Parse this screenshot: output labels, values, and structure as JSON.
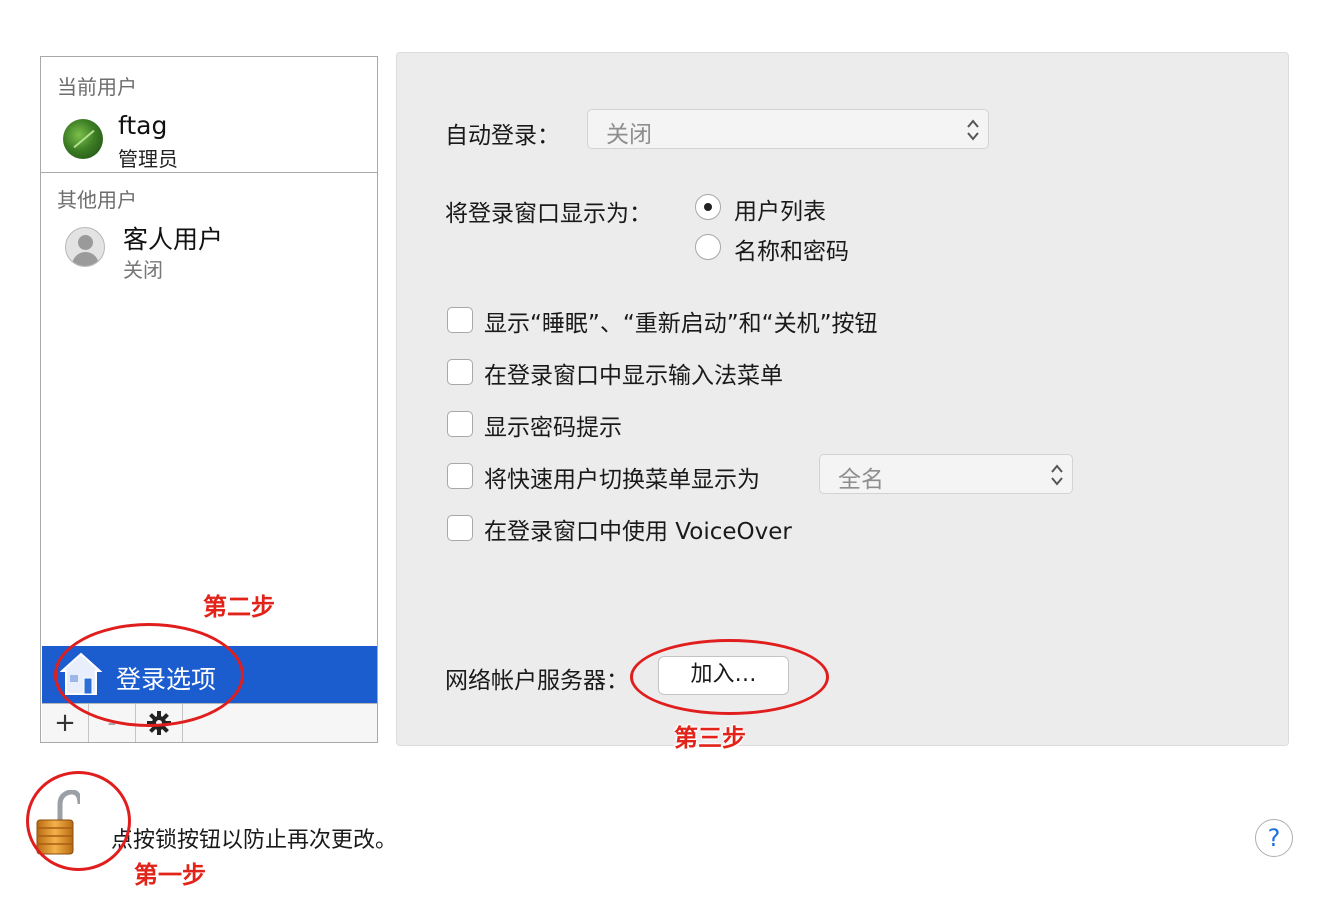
{
  "sidebar": {
    "current_users_header": "当前用户",
    "current_user": {
      "name": "ftag",
      "role": "管理员"
    },
    "other_users_header": "其他用户",
    "guest_user": {
      "name": "客人用户",
      "status": "关闭"
    },
    "login_options_label": "登录选项",
    "toolbar": {
      "add": "+",
      "remove": "-",
      "gear": "✱"
    }
  },
  "main": {
    "auto_login": {
      "label": "自动登录：",
      "value": "关闭"
    },
    "display_login_window": {
      "label": "将登录窗口显示为：",
      "options": [
        "用户列表",
        "名称和密码"
      ],
      "selected": "用户列表"
    },
    "checkboxes": [
      "显示“睡眠”、“重新启动”和“关机”按钮",
      "在登录窗口中显示输入法菜单",
      "显示密码提示",
      "将快速用户切换菜单显示为",
      "在登录窗口中使用 VoiceOver"
    ],
    "fast_user_switch_value": "全名",
    "network_server": {
      "label": "网络帐户服务器：",
      "button": "加入…"
    }
  },
  "footer": {
    "lock_text": "点按锁按钮以防止再次更改。",
    "help": "?"
  },
  "annotations": {
    "step1": "第一步",
    "step2": "第二步",
    "step3": "第三步",
    "color": "#e2231a"
  },
  "colors": {
    "selection_blue": "#1b5ccf",
    "panel_bg": "#ececec"
  }
}
